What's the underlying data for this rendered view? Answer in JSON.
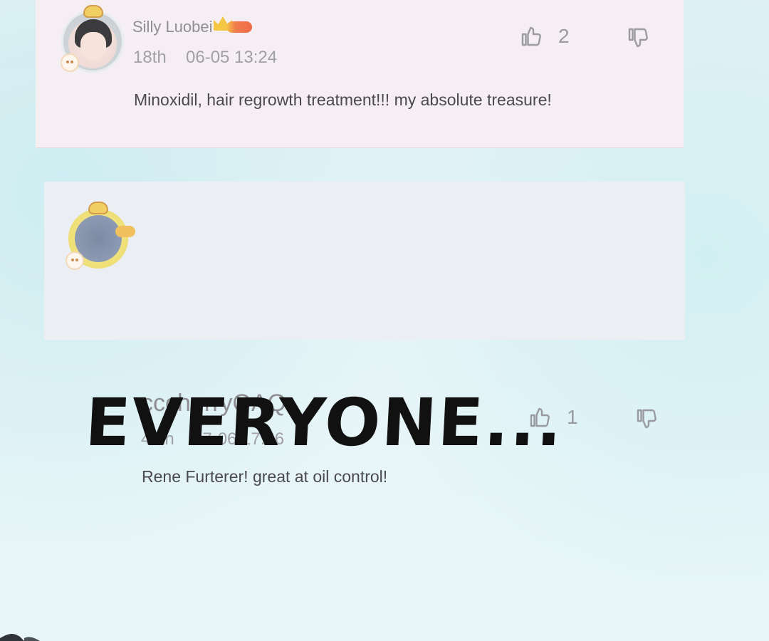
{
  "comments": [
    {
      "username": "Silly Luobei",
      "floor": "18th",
      "timestamp": "06-05 13:24",
      "text": "Minoxidil, hair regrowth treatment!!! my absolute treasure!",
      "likes": "2"
    },
    {
      "username": "cccherryQAQ",
      "floor": "40th",
      "timestamp": "07-06 17:36",
      "text": "Rene Furterer! great at oil control!",
      "likes": "1"
    }
  ],
  "caption": "EVERYONE...",
  "colors": {
    "card_one_bg": "#f5eef3",
    "card_two_bg": "#ebeef3",
    "meta_text": "#a0a0a6",
    "comment_text": "#4a4a4d",
    "caption_text": "#111111",
    "crown_gold": "#f4c844",
    "level_orange": "#ef6a4a"
  },
  "icons": {
    "like": "thumbs-up-icon",
    "dislike": "thumbs-down-icon",
    "crown": "crown-icon"
  }
}
